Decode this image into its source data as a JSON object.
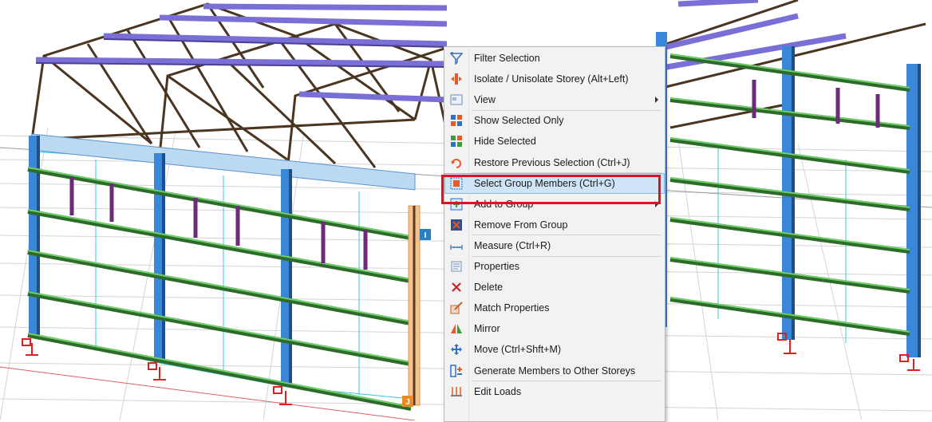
{
  "viewport": {
    "node_labels": {
      "i": "I",
      "j": "J"
    }
  },
  "context_menu": {
    "items": [
      {
        "label": "Filter Selection",
        "icon": "filter-icon",
        "submenu": false
      },
      {
        "label": "Isolate / Unisolate Storey (Alt+Left)",
        "icon": "isolate-storey-icon",
        "submenu": false
      },
      {
        "label": "View",
        "icon": "view-icon",
        "submenu": true
      },
      {
        "label": "Show Selected Only",
        "icon": "show-selected-icon",
        "submenu": false
      },
      {
        "label": "Hide Selected",
        "icon": "hide-selected-icon",
        "submenu": false
      },
      {
        "label": "Restore Previous Selection (Ctrl+J)",
        "icon": "restore-selection-icon",
        "submenu": false
      },
      {
        "label": "Select Group Members (Ctrl+G)",
        "icon": "select-group-icon",
        "submenu": false,
        "highlighted": true
      },
      {
        "label": "Add to Group",
        "icon": "add-to-group-icon",
        "submenu": true
      },
      {
        "label": "Remove From Group",
        "icon": "remove-from-group-icon",
        "submenu": false
      },
      {
        "label": "Measure (Ctrl+R)",
        "icon": "measure-icon",
        "submenu": false
      },
      {
        "label": "Properties",
        "icon": "properties-icon",
        "submenu": false
      },
      {
        "label": "Delete",
        "icon": "delete-icon",
        "submenu": false
      },
      {
        "label": "Match Properties",
        "icon": "match-properties-icon",
        "submenu": false
      },
      {
        "label": "Mirror",
        "icon": "mirror-icon",
        "submenu": false
      },
      {
        "label": "Move (Ctrl+Shft+M)",
        "icon": "move-icon",
        "submenu": false
      },
      {
        "label": "Generate Members to Other Storeys",
        "icon": "generate-members-icon",
        "submenu": false
      },
      {
        "label": "Edit Loads",
        "icon": "edit-loads-icon",
        "submenu": false
      }
    ]
  },
  "colors": {
    "column_blue": "#3a86d8",
    "truss_brown": "#4a3520",
    "purlin_purple": "#7a6fd6",
    "girt_green": "#3f9a3a",
    "selected_member": "#f6c18c",
    "highlight_red": "#e4111b"
  }
}
